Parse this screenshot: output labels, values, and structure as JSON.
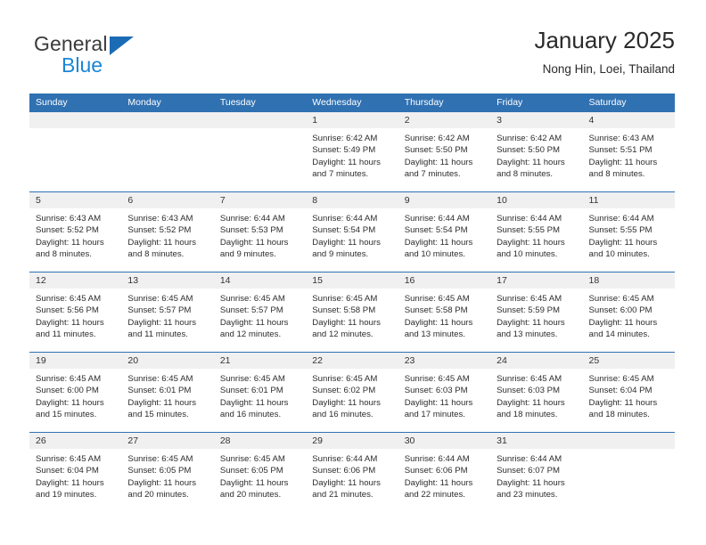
{
  "brand": {
    "name_part1": "General",
    "name_part2": "Blue",
    "mark_color": "#1b6cb5",
    "text_color": "#1b86d6"
  },
  "header": {
    "title": "January 2025",
    "subtitle": "Nong Hin, Loei, Thailand"
  },
  "theme": {
    "header_blue": "#3071b2",
    "day_band_gray": "#f0f0f0",
    "text_color": "#2d2d2d"
  },
  "weekdays": [
    "Sunday",
    "Monday",
    "Tuesday",
    "Wednesday",
    "Thursday",
    "Friday",
    "Saturday"
  ],
  "weeks": [
    [
      {
        "day": "",
        "lines": []
      },
      {
        "day": "",
        "lines": []
      },
      {
        "day": "",
        "lines": []
      },
      {
        "day": "1",
        "lines": [
          "Sunrise: 6:42 AM",
          "Sunset: 5:49 PM",
          "Daylight: 11 hours",
          "and 7 minutes."
        ]
      },
      {
        "day": "2",
        "lines": [
          "Sunrise: 6:42 AM",
          "Sunset: 5:50 PM",
          "Daylight: 11 hours",
          "and 7 minutes."
        ]
      },
      {
        "day": "3",
        "lines": [
          "Sunrise: 6:42 AM",
          "Sunset: 5:50 PM",
          "Daylight: 11 hours",
          "and 8 minutes."
        ]
      },
      {
        "day": "4",
        "lines": [
          "Sunrise: 6:43 AM",
          "Sunset: 5:51 PM",
          "Daylight: 11 hours",
          "and 8 minutes."
        ]
      }
    ],
    [
      {
        "day": "5",
        "lines": [
          "Sunrise: 6:43 AM",
          "Sunset: 5:52 PM",
          "Daylight: 11 hours",
          "and 8 minutes."
        ]
      },
      {
        "day": "6",
        "lines": [
          "Sunrise: 6:43 AM",
          "Sunset: 5:52 PM",
          "Daylight: 11 hours",
          "and 8 minutes."
        ]
      },
      {
        "day": "7",
        "lines": [
          "Sunrise: 6:44 AM",
          "Sunset: 5:53 PM",
          "Daylight: 11 hours",
          "and 9 minutes."
        ]
      },
      {
        "day": "8",
        "lines": [
          "Sunrise: 6:44 AM",
          "Sunset: 5:54 PM",
          "Daylight: 11 hours",
          "and 9 minutes."
        ]
      },
      {
        "day": "9",
        "lines": [
          "Sunrise: 6:44 AM",
          "Sunset: 5:54 PM",
          "Daylight: 11 hours",
          "and 10 minutes."
        ]
      },
      {
        "day": "10",
        "lines": [
          "Sunrise: 6:44 AM",
          "Sunset: 5:55 PM",
          "Daylight: 11 hours",
          "and 10 minutes."
        ]
      },
      {
        "day": "11",
        "lines": [
          "Sunrise: 6:44 AM",
          "Sunset: 5:55 PM",
          "Daylight: 11 hours",
          "and 10 minutes."
        ]
      }
    ],
    [
      {
        "day": "12",
        "lines": [
          "Sunrise: 6:45 AM",
          "Sunset: 5:56 PM",
          "Daylight: 11 hours",
          "and 11 minutes."
        ]
      },
      {
        "day": "13",
        "lines": [
          "Sunrise: 6:45 AM",
          "Sunset: 5:57 PM",
          "Daylight: 11 hours",
          "and 11 minutes."
        ]
      },
      {
        "day": "14",
        "lines": [
          "Sunrise: 6:45 AM",
          "Sunset: 5:57 PM",
          "Daylight: 11 hours",
          "and 12 minutes."
        ]
      },
      {
        "day": "15",
        "lines": [
          "Sunrise: 6:45 AM",
          "Sunset: 5:58 PM",
          "Daylight: 11 hours",
          "and 12 minutes."
        ]
      },
      {
        "day": "16",
        "lines": [
          "Sunrise: 6:45 AM",
          "Sunset: 5:58 PM",
          "Daylight: 11 hours",
          "and 13 minutes."
        ]
      },
      {
        "day": "17",
        "lines": [
          "Sunrise: 6:45 AM",
          "Sunset: 5:59 PM",
          "Daylight: 11 hours",
          "and 13 minutes."
        ]
      },
      {
        "day": "18",
        "lines": [
          "Sunrise: 6:45 AM",
          "Sunset: 6:00 PM",
          "Daylight: 11 hours",
          "and 14 minutes."
        ]
      }
    ],
    [
      {
        "day": "19",
        "lines": [
          "Sunrise: 6:45 AM",
          "Sunset: 6:00 PM",
          "Daylight: 11 hours",
          "and 15 minutes."
        ]
      },
      {
        "day": "20",
        "lines": [
          "Sunrise: 6:45 AM",
          "Sunset: 6:01 PM",
          "Daylight: 11 hours",
          "and 15 minutes."
        ]
      },
      {
        "day": "21",
        "lines": [
          "Sunrise: 6:45 AM",
          "Sunset: 6:01 PM",
          "Daylight: 11 hours",
          "and 16 minutes."
        ]
      },
      {
        "day": "22",
        "lines": [
          "Sunrise: 6:45 AM",
          "Sunset: 6:02 PM",
          "Daylight: 11 hours",
          "and 16 minutes."
        ]
      },
      {
        "day": "23",
        "lines": [
          "Sunrise: 6:45 AM",
          "Sunset: 6:03 PM",
          "Daylight: 11 hours",
          "and 17 minutes."
        ]
      },
      {
        "day": "24",
        "lines": [
          "Sunrise: 6:45 AM",
          "Sunset: 6:03 PM",
          "Daylight: 11 hours",
          "and 18 minutes."
        ]
      },
      {
        "day": "25",
        "lines": [
          "Sunrise: 6:45 AM",
          "Sunset: 6:04 PM",
          "Daylight: 11 hours",
          "and 18 minutes."
        ]
      }
    ],
    [
      {
        "day": "26",
        "lines": [
          "Sunrise: 6:45 AM",
          "Sunset: 6:04 PM",
          "Daylight: 11 hours",
          "and 19 minutes."
        ]
      },
      {
        "day": "27",
        "lines": [
          "Sunrise: 6:45 AM",
          "Sunset: 6:05 PM",
          "Daylight: 11 hours",
          "and 20 minutes."
        ]
      },
      {
        "day": "28",
        "lines": [
          "Sunrise: 6:45 AM",
          "Sunset: 6:05 PM",
          "Daylight: 11 hours",
          "and 20 minutes."
        ]
      },
      {
        "day": "29",
        "lines": [
          "Sunrise: 6:44 AM",
          "Sunset: 6:06 PM",
          "Daylight: 11 hours",
          "and 21 minutes."
        ]
      },
      {
        "day": "30",
        "lines": [
          "Sunrise: 6:44 AM",
          "Sunset: 6:06 PM",
          "Daylight: 11 hours",
          "and 22 minutes."
        ]
      },
      {
        "day": "31",
        "lines": [
          "Sunrise: 6:44 AM",
          "Sunset: 6:07 PM",
          "Daylight: 11 hours",
          "and 23 minutes."
        ]
      },
      {
        "day": "",
        "lines": []
      }
    ]
  ]
}
